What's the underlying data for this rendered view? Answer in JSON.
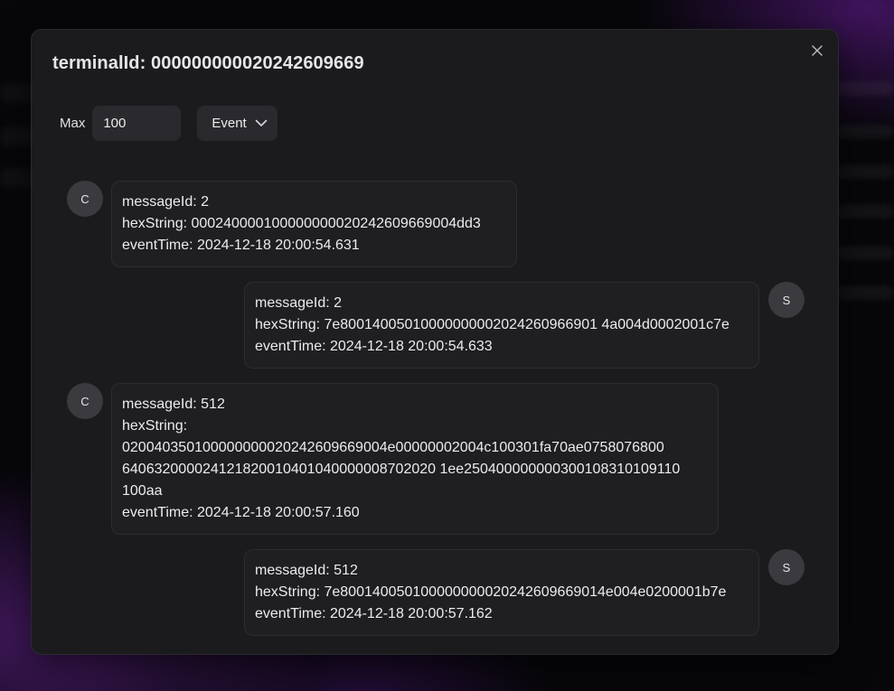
{
  "dialog": {
    "title": "terminalId: 000000000020242609669",
    "close_icon": "close-icon"
  },
  "controls": {
    "max_label": "Max",
    "max_value": "100",
    "event_label": "Event",
    "event_icon": "chevron-down-icon"
  },
  "messages": [
    {
      "side": "C",
      "message_id": "messageId: 2",
      "hex_label": "hexString: ",
      "hex": "000240000100000000020242609669004dd3",
      "event_time": "eventTime: 2024-12-18 20:00:54.631"
    },
    {
      "side": "S",
      "message_id": "messageId: 2",
      "hex_label": "hexString: ",
      "hex": "7e80014005010000000002024260966901 4a004d0002001c7e",
      "event_time": "eventTime: 2024-12-18 20:00:54.633"
    },
    {
      "side": "C",
      "message_id": "messageId: 512",
      "hex_label": "hexString:",
      "hex_lines": [
        "020040350100000000020242609669004e00000002004c100301fa70ae0758076800",
        "640632000024121820010401040000008702020 1ee250400000000300108310109110",
        "100aa"
      ],
      "event_time": "eventTime: 2024-12-18 20:00:57.160"
    },
    {
      "side": "S",
      "message_id": "messageId: 512",
      "hex_label": "hexString: ",
      "hex": "7e800140050100000000020242609669014e004e0200001b7e",
      "event_time": "eventTime: 2024-12-18 20:00:57.162"
    }
  ]
}
